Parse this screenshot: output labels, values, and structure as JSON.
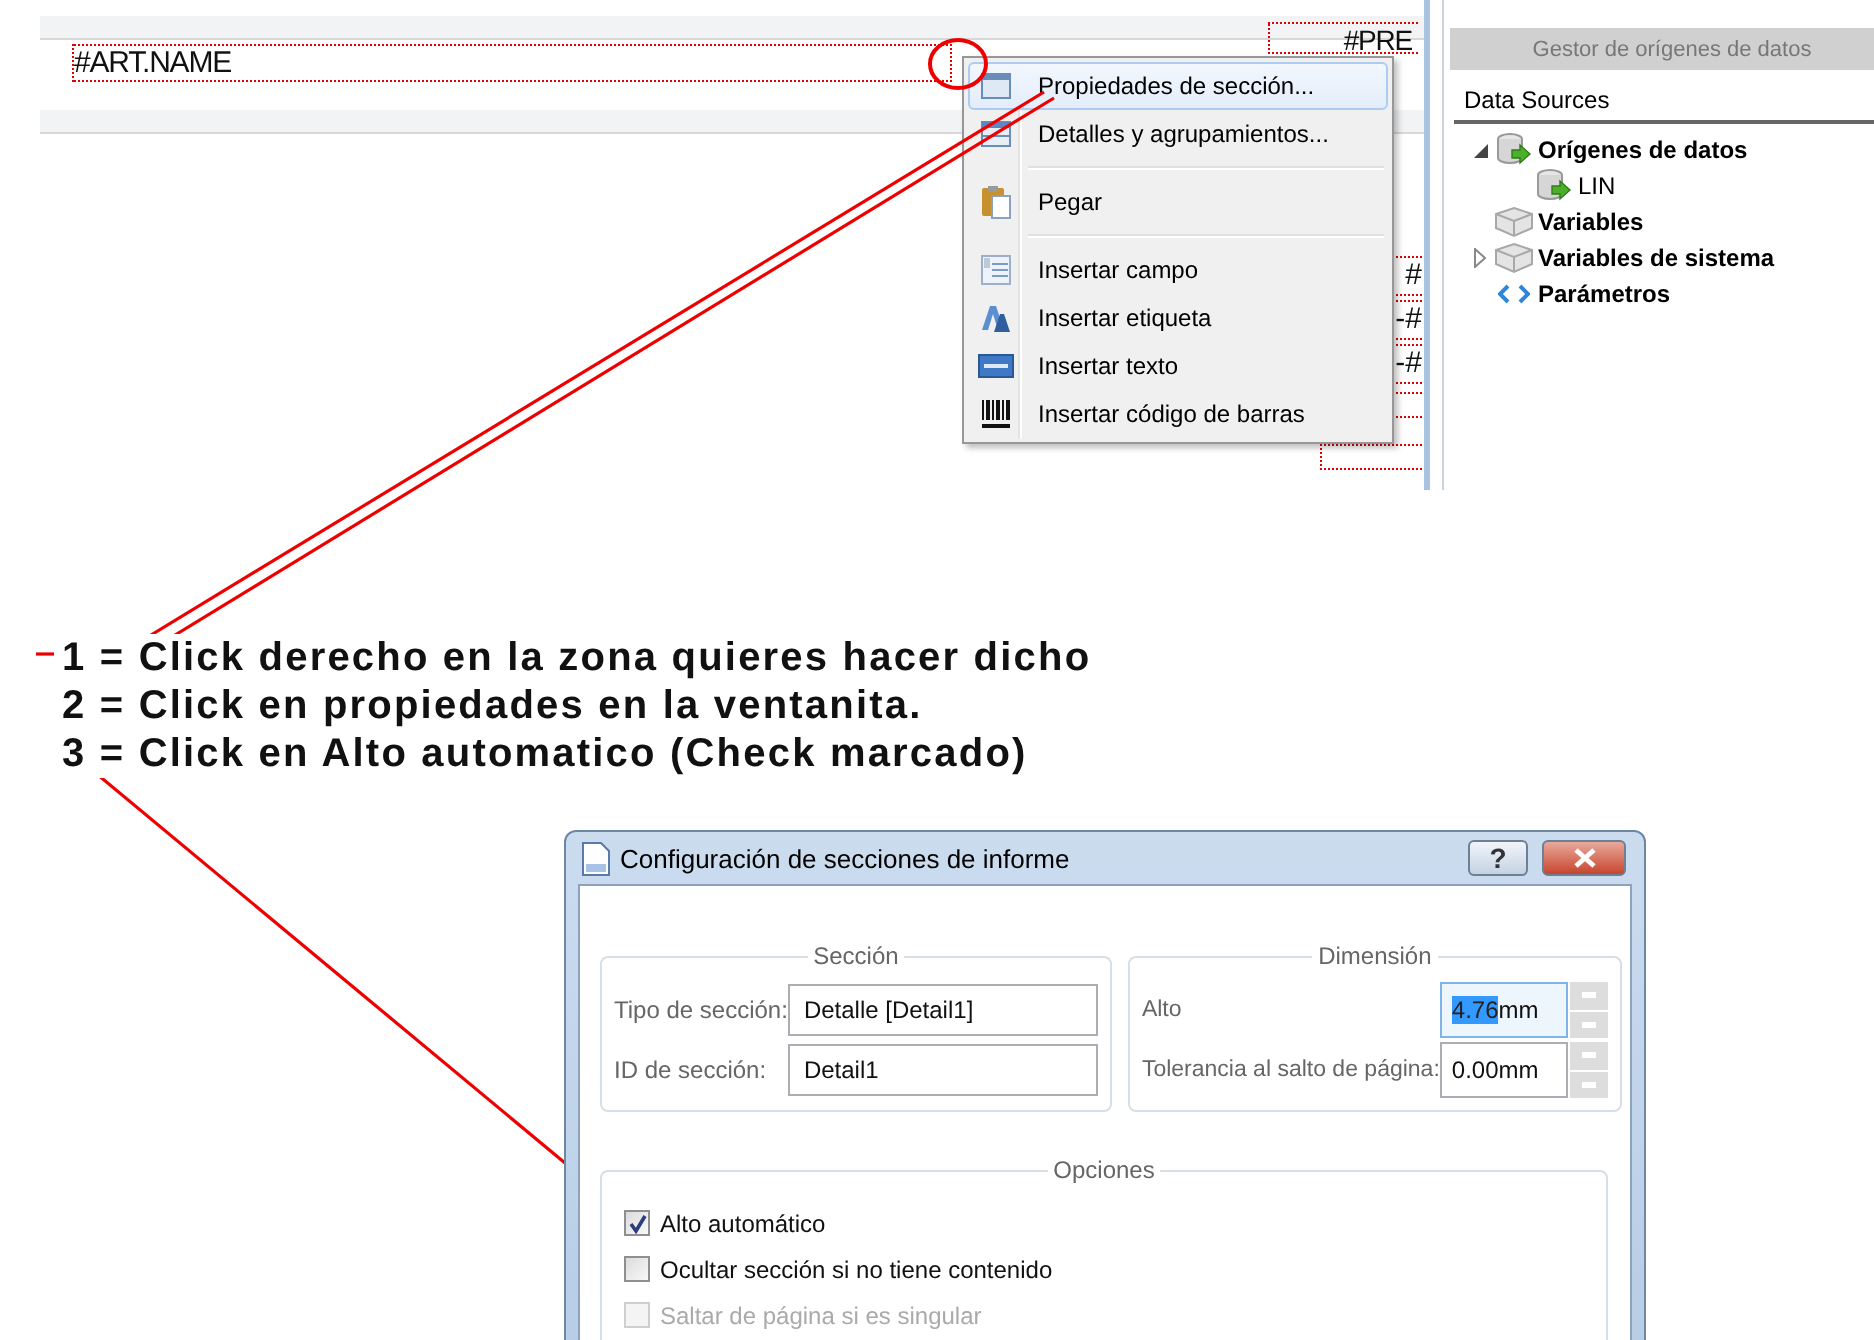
{
  "designer": {
    "field_label": "#ART.NAME",
    "cut_fields": [
      "#PRE",
      "#",
      "-#",
      "-#"
    ]
  },
  "context_menu": {
    "groups": [
      [
        {
          "label": "Propiedades de sección...",
          "selected": true
        },
        {
          "label": "Detalles y agrupamientos...",
          "selected": false
        }
      ],
      [
        {
          "label": "Pegar",
          "selected": false
        }
      ],
      [
        {
          "label": "Insertar campo",
          "selected": false
        },
        {
          "label": "Insertar etiqueta",
          "selected": false
        },
        {
          "label": "Insertar texto",
          "selected": false
        },
        {
          "label": "Insertar código de barras",
          "selected": false
        }
      ]
    ]
  },
  "data_panel": {
    "header": "Gestor de orígenes de datos",
    "title": "Data Sources",
    "tree": [
      {
        "label": "Orígenes de datos",
        "kind": "datasource",
        "expanded": true,
        "children": [
          {
            "label": "LIN",
            "kind": "datasource"
          }
        ]
      },
      {
        "label": "Variables",
        "kind": "variables"
      },
      {
        "label": "Variables de sistema",
        "kind": "variables",
        "expanded": false
      },
      {
        "label": "Parámetros",
        "kind": "parameters"
      }
    ]
  },
  "instructions": [
    "1 = Click derecho en la zona quieres hacer dicho",
    "2 = Click en propiedades en la ventanita.",
    "3 = Click en Alto automatico (Check marcado)"
  ],
  "dialog": {
    "title": "Configuración de secciones de informe",
    "help_button": "?",
    "section": {
      "legend": "Sección",
      "fields": [
        {
          "label": "Tipo de sección:",
          "value": "Detalle [Detail1]"
        },
        {
          "label": "ID de sección:",
          "value": "Detail1"
        }
      ]
    },
    "dimension": {
      "legend": "Dimensión",
      "fields": [
        {
          "label": "Alto",
          "selected_text": "4.76",
          "value": "mm",
          "focused": true
        },
        {
          "label": "Tolerancia al salto de página:",
          "value": "0.00mm",
          "focused": false
        }
      ]
    },
    "options": {
      "legend": "Opciones",
      "checks": [
        {
          "label": "Alto automático",
          "checked": true,
          "disabled": false
        },
        {
          "label": "Ocultar sección si no tiene contenido",
          "checked": false,
          "disabled": false
        },
        {
          "label": "Saltar de página si es singular",
          "checked": false,
          "disabled": true
        }
      ]
    }
  }
}
